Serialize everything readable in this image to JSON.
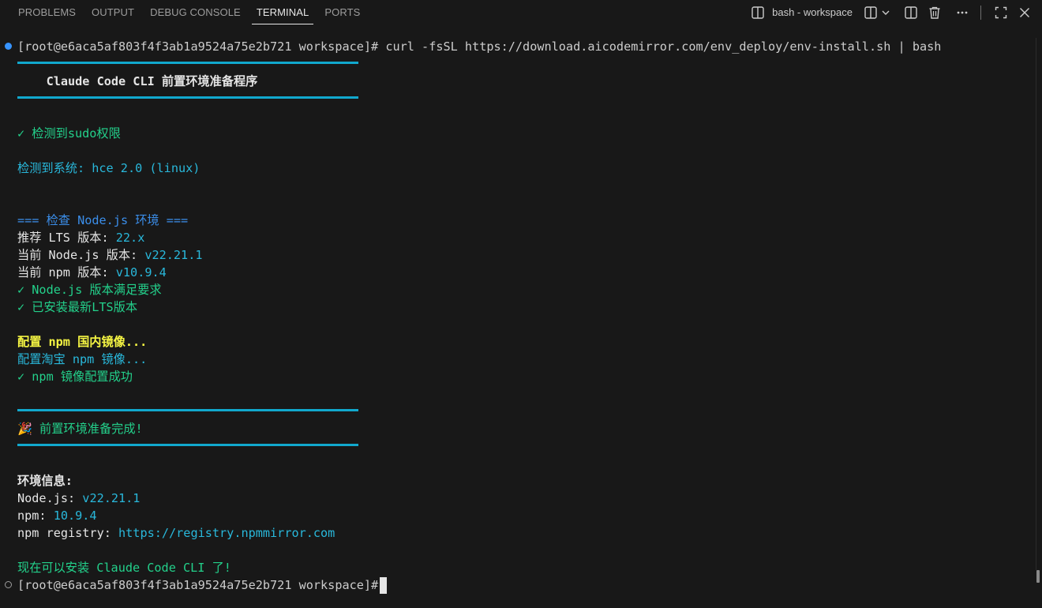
{
  "tabs": [
    {
      "label": "PROBLEMS"
    },
    {
      "label": "OUTPUT"
    },
    {
      "label": "DEBUG CONSOLE"
    },
    {
      "label": "TERMINAL"
    },
    {
      "label": "PORTS"
    }
  ],
  "active_tab": "TERMINAL",
  "toolbar": {
    "terminal_name": "bash - workspace",
    "terminal_icon": "terminal-split-icon",
    "actions": [
      "split-terminal-icon",
      "chevron-down-icon",
      "split-editor-icon",
      "trash-icon",
      "more-icon",
      "maximize-icon",
      "close-icon"
    ]
  },
  "terminal": {
    "prompt_1": "[root@e6aca5af803f4f3ab1a9524a75e2b721 workspace]# ",
    "command_1": "curl -fsSL https://download.aicodemirror.com/env_deploy/env-install.sh | bash",
    "banner_title": "    Claude Code CLI 前置环境准备程序",
    "sudo_ok": "✓ 检测到sudo权限",
    "system_label": "检测到系统: ",
    "system_value": "hce 2.0 (linux)",
    "node_header": "=== 检查 Node.js 环境 ===",
    "lts_label": "推荐 LTS 版本: ",
    "lts_value": "22.x",
    "node_current_label": "当前 Node.js 版本: ",
    "node_current_value": "v22.21.1",
    "npm_current_label": "当前 npm 版本: ",
    "npm_current_value": "v10.9.4",
    "node_ok": "✓ Node.js 版本满足要求",
    "lts_ok": "✓ 已安装最新LTS版本",
    "npm_mirror_heading": "配置 npm 国内镜像...",
    "npm_taobao": "配置淘宝 npm 镜像...",
    "npm_mirror_ok": "✓ npm 镜像配置成功",
    "done_message": "🎉 前置环境准备完成!",
    "env_info_heading": "环境信息:",
    "env_node_label": "Node.js: ",
    "env_node_value": "v22.21.1",
    "env_npm_label": "npm: ",
    "env_npm_value": "10.9.4",
    "env_registry_label": "npm registry: ",
    "env_registry_value": "https://registry.npmmirror.com",
    "final_message": "现在可以安装 Claude Code CLI 了!",
    "prompt_2": "[root@e6aca5af803f4f3ab1a9524a75e2b721 workspace]# "
  },
  "colors": {
    "background": "#181818",
    "rule": "#11a8cd",
    "green": "#23d18b",
    "cyan": "#29b8db",
    "blue": "#3b8eea",
    "yellow": "#f5f543",
    "foreground": "#cccccc"
  }
}
